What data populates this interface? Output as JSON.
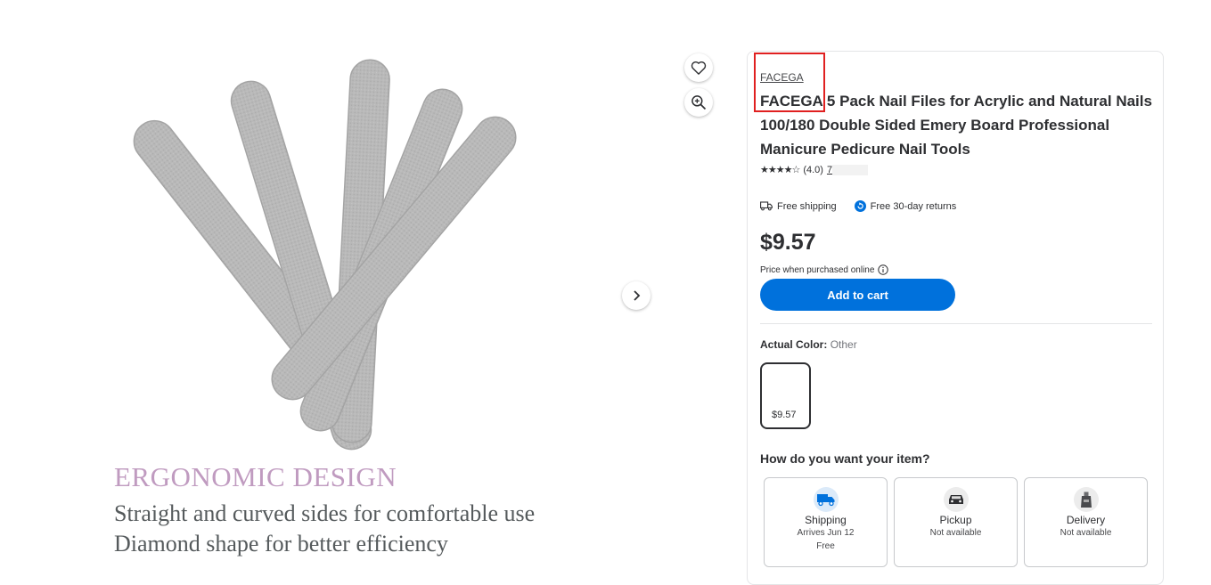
{
  "gallery": {
    "caption_title": "ERGONOMIC DESIGN",
    "caption_line1": "Straight and curved sides for comfortable use",
    "caption_line2": "Diamond shape for better efficiency",
    "favorite_icon": "heart-icon",
    "zoom_icon": "zoom-in-icon",
    "next_icon": "chevron-right-icon"
  },
  "product": {
    "brand": "FACEGA",
    "title": "FACEGA 5 Pack Nail Files for Acrylic and Natural Nails 100/180 Double Sided Emery Board Professional Manicure Pedicure Nail Tools",
    "stars": "★★★★☆",
    "rating": "(4.0)",
    "review_count": "7",
    "benefits": {
      "shipping": "Free shipping",
      "returns": "Free 30-day returns"
    },
    "price": "$9.57",
    "price_note": "Price when purchased online",
    "add_to_cart": "Add to cart"
  },
  "variant": {
    "label": "Actual Color:",
    "value": "Other",
    "swatch_price": "$9.57"
  },
  "fulfillment": {
    "question": "How do you want your item?",
    "options": [
      {
        "title": "Shipping",
        "line1": "Arrives Jun 12",
        "line2": "Free",
        "icon": "truck-icon"
      },
      {
        "title": "Pickup",
        "line1": "Not available",
        "line2": "",
        "icon": "car-icon"
      },
      {
        "title": "Delivery",
        "line1": "Not available",
        "line2": "",
        "icon": "delivery-bag-icon"
      }
    ]
  },
  "colors": {
    "accent": "#0071dc",
    "highlight": "#e02020",
    "caption_pink": "#c09bc0"
  }
}
